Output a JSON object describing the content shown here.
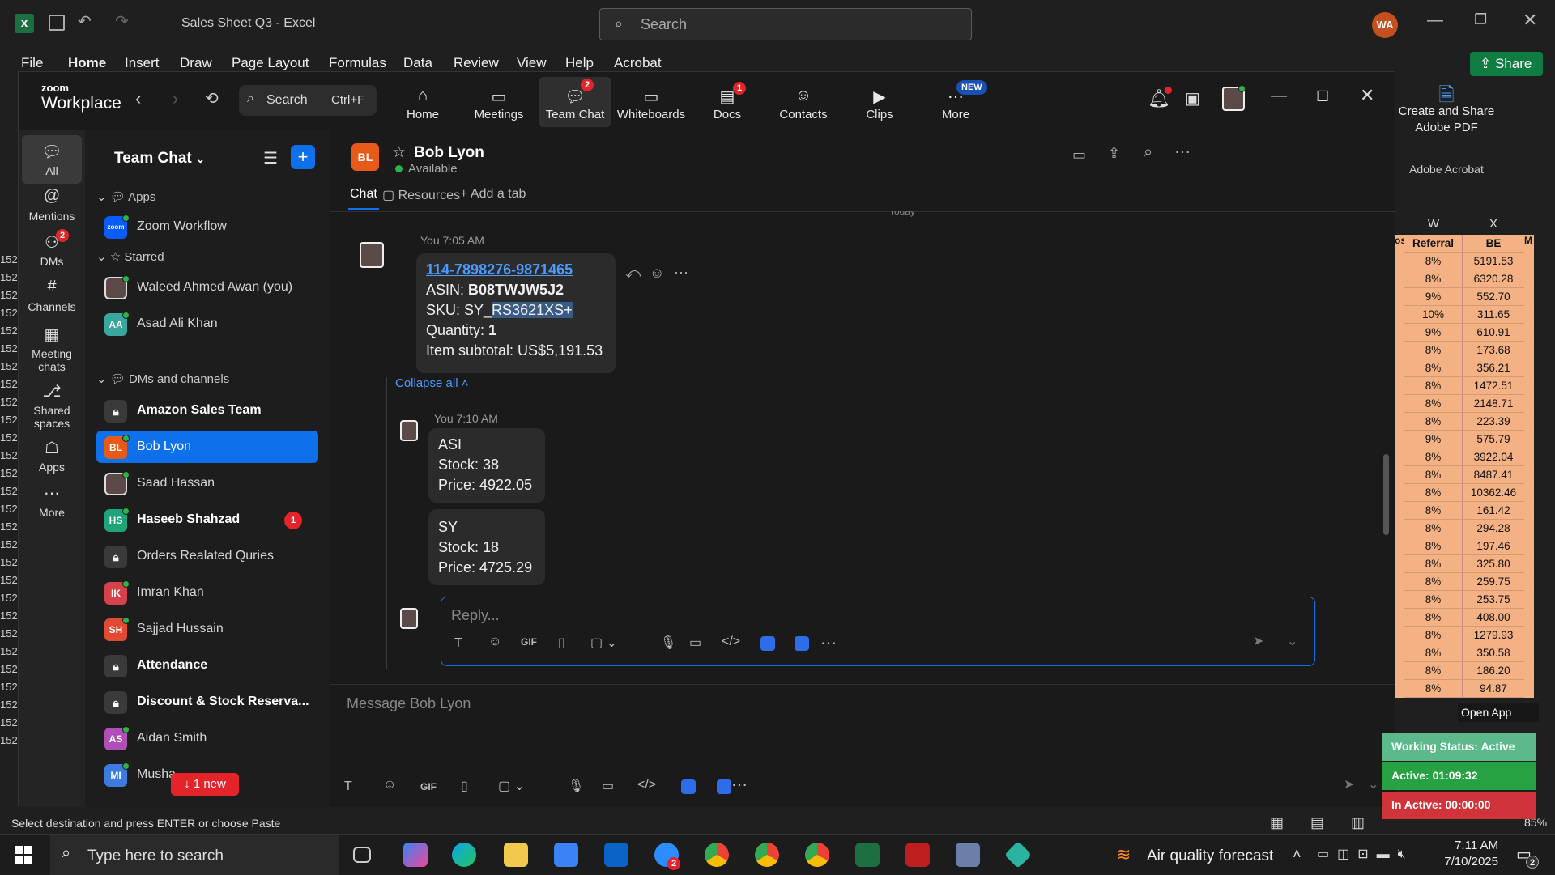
{
  "excel": {
    "title": "Sales Sheet Q3 - Excel",
    "search_placeholder": "Search",
    "avatar": "WA",
    "share": "Share",
    "menu": [
      "File",
      "Home",
      "Insert",
      "Draw",
      "Page Layout",
      "Formulas",
      "Data",
      "Review",
      "View",
      "Help",
      "Acrobat"
    ],
    "acrobat_panel": {
      "line1": "Create and Share",
      "line2": "Adobe PDF",
      "group": "Adobe Acrobat"
    },
    "columns": [
      "W",
      "X"
    ],
    "header_row": [
      "ost",
      "Referral",
      "BE",
      "M"
    ],
    "rows": [
      [
        "8%",
        "5191.53"
      ],
      [
        "8%",
        "6320.28"
      ],
      [
        "9%",
        "552.70"
      ],
      [
        "10%",
        "311.65"
      ],
      [
        "9%",
        "610.91"
      ],
      [
        "8%",
        "173.68"
      ],
      [
        "8%",
        "356.21"
      ],
      [
        "8%",
        "1472.51"
      ],
      [
        "8%",
        "2148.71"
      ],
      [
        "8%",
        "223.39"
      ],
      [
        "9%",
        "575.79"
      ],
      [
        "8%",
        "3922.04"
      ],
      [
        "8%",
        "8487.41"
      ],
      [
        "8%",
        "10362.46"
      ],
      [
        "8%",
        "161.42"
      ],
      [
        "8%",
        "294.28"
      ],
      [
        "8%",
        "197.46"
      ],
      [
        "8%",
        "325.80"
      ],
      [
        "8%",
        "259.75"
      ],
      [
        "8%",
        "253.75"
      ],
      [
        "8%",
        "408.00"
      ],
      [
        "8%",
        "1279.93"
      ],
      [
        "8%",
        "350.58"
      ],
      [
        "8%",
        "186.20"
      ],
      [
        "8%",
        "94.87"
      ]
    ],
    "row_numbers": [
      "152",
      "152",
      "152",
      "152",
      "152",
      "152",
      "152",
      "152",
      "152",
      "152",
      "152",
      "152",
      "152",
      "152",
      "152",
      "152",
      "152",
      "152",
      "152",
      "152",
      "152",
      "152",
      "152",
      "152",
      "152",
      "152",
      "152",
      "152"
    ],
    "status_text": "Select destination and press ENTER or choose Paste",
    "zoom_level": "85%"
  },
  "zoom": {
    "brand_top": "zoom",
    "brand_bottom": "Workplace",
    "search_label": "Search",
    "search_shortcut": "Ctrl+F",
    "nav": [
      {
        "label": "Home",
        "icon": "home-icon"
      },
      {
        "label": "Meetings",
        "icon": "camera-icon"
      },
      {
        "label": "Team Chat",
        "icon": "chat-icon",
        "badge": "2"
      },
      {
        "label": "Whiteboards",
        "icon": "whiteboard-icon"
      },
      {
        "label": "Docs",
        "icon": "docs-icon",
        "badge": "1"
      },
      {
        "label": "Contacts",
        "icon": "contacts-icon"
      },
      {
        "label": "Clips",
        "icon": "clips-icon"
      },
      {
        "label": "More",
        "icon": "more-icon",
        "badge": "NEW"
      }
    ],
    "rail": [
      {
        "label": "All",
        "icon": "chat-bubble-icon"
      },
      {
        "label": "Mentions",
        "icon": "at-icon"
      },
      {
        "label": "DMs",
        "icon": "people-icon",
        "badge": "2"
      },
      {
        "label": "Channels",
        "icon": "hash-icon"
      },
      {
        "label": "Meeting chats",
        "icon": "calendar-icon"
      },
      {
        "label": "Shared spaces",
        "icon": "share-icon"
      },
      {
        "label": "Apps",
        "icon": "apps-icon"
      },
      {
        "label": "More",
        "icon": "ellipsis-icon"
      }
    ],
    "sidebar": {
      "title": "Team Chat",
      "sections": {
        "apps": "Apps",
        "starred": "Starred",
        "dms": "DMs and channels"
      },
      "apps": [
        {
          "label": "Zoom Workflow",
          "avatar": "zoom"
        }
      ],
      "starred": [
        {
          "label": "Waleed Ahmed Awan (you)",
          "avatar": ""
        },
        {
          "label": "Asad Ali Khan",
          "avatar": "AA"
        }
      ],
      "dms": [
        {
          "label": "Amazon Sales Team",
          "avatar": "",
          "bold": true
        },
        {
          "label": "Bob Lyon",
          "avatar": "BL",
          "selected": true
        },
        {
          "label": "Saad Hassan",
          "avatar": ""
        },
        {
          "label": "Haseeb Shahzad",
          "avatar": "HS",
          "bold": true,
          "badge": "1"
        },
        {
          "label": "Orders Realated Quries",
          "avatar": ""
        },
        {
          "label": "Imran Khan",
          "avatar": "IK"
        },
        {
          "label": "Sajjad Hussain",
          "avatar": "SH"
        },
        {
          "label": "Attendance",
          "avatar": "",
          "bold": true
        },
        {
          "label": "Discount & Stock Reserva...",
          "avatar": "",
          "bold": true
        },
        {
          "label": "Aidan Smith",
          "avatar": "AS"
        },
        {
          "label": "Musha",
          "avatar": "MI"
        }
      ],
      "new_pill": "↓ 1 new"
    },
    "chat": {
      "contact_initials": "BL",
      "contact_name": "Bob Lyon",
      "status": "Available",
      "tabs": [
        "Chat",
        "Resources",
        "Add a tab"
      ],
      "today": "Today",
      "message1": {
        "time": "You 7:05 AM",
        "link": "114-7898276-9871465",
        "asin_label": "ASIN: ",
        "asin": "B08TWJW5J2",
        "sku_label": "SKU: SY_",
        "sku": "RS3621XS+",
        "qty_label": "Quantity: ",
        "qty": "1",
        "subtotal": "Item subtotal: US$5,191.53"
      },
      "collapse": "Collapse all",
      "reply1_time": "You 7:10 AM",
      "reply1": [
        "ASI",
        "Stock: 38",
        "Price: 4922.05"
      ],
      "reply2": [
        "SY",
        "Stock: 18",
        "Price: 4725.29"
      ],
      "reply_placeholder": "Reply...",
      "message_placeholder": "Message Bob Lyon"
    }
  },
  "tracker": {
    "open_app": "Open App",
    "working_status": "Working Status: Active",
    "active": "Active: 01:09:32",
    "inactive": "In Active: 00:00:00"
  },
  "taskbar": {
    "search_placeholder": "Type here to search",
    "weather": "Air quality forecast",
    "time": "7:11 AM",
    "date": "7/10/2025",
    "notif_count": "2"
  }
}
